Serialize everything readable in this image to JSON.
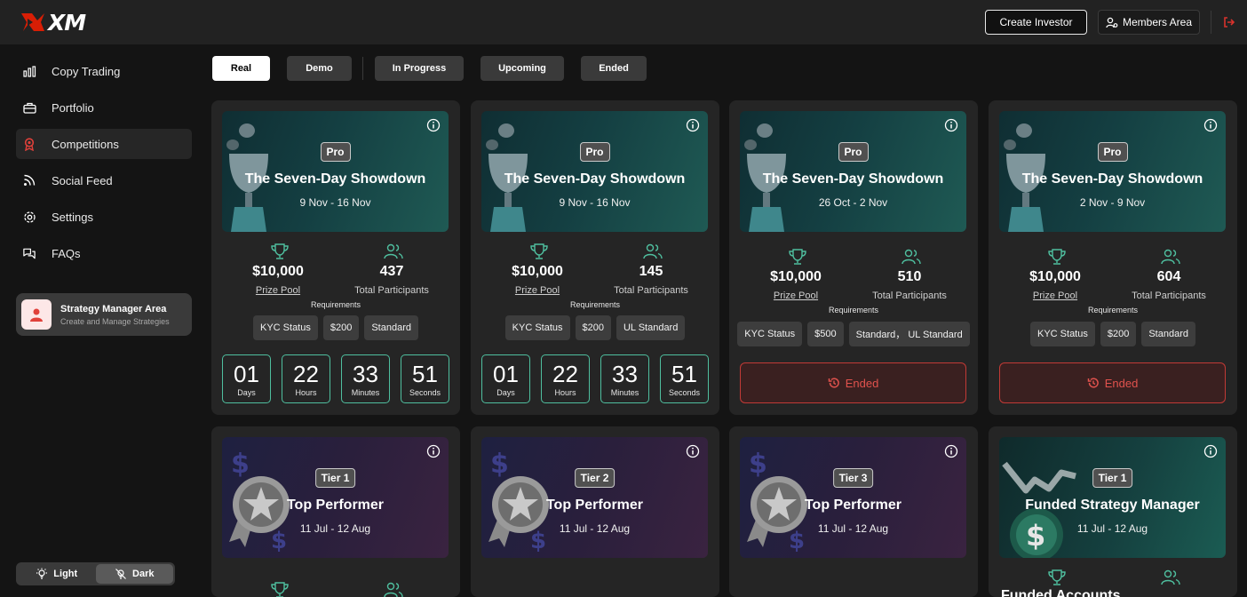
{
  "header": {
    "logo_text": "XM",
    "create_investor": "Create Investor",
    "members_area": "Members Area"
  },
  "sidebar": {
    "items": [
      {
        "label": "Copy Trading",
        "icon": "bar-chart-icon"
      },
      {
        "label": "Portfolio",
        "icon": "briefcase-icon"
      },
      {
        "label": "Competitions",
        "icon": "award-icon",
        "active": true
      },
      {
        "label": "Social Feed",
        "icon": "rss-icon"
      },
      {
        "label": "Settings",
        "icon": "gear-icon"
      },
      {
        "label": "FAQs",
        "icon": "chat-bubbles-icon"
      }
    ],
    "strategy_area": {
      "title": "Strategy Manager Area",
      "subtitle": "Create and Manage Strategies"
    },
    "theme": {
      "light": "Light",
      "dark": "Dark",
      "selected": "Dark"
    }
  },
  "tabs": [
    {
      "label": "Real",
      "active": true
    },
    {
      "label": "Demo"
    },
    {
      "label": "In Progress"
    },
    {
      "label": "Upcoming"
    },
    {
      "label": "Ended"
    }
  ],
  "labels": {
    "prize_pool": "Prize Pool",
    "total_participants": "Total Participants",
    "requirements": "Requirements",
    "ended": "Ended",
    "days": "Days",
    "hours": "Hours",
    "minutes": "Minutes",
    "seconds": "Seconds"
  },
  "competitions": [
    {
      "badge": "Pro",
      "title": "The Seven-Day Showdown",
      "dates": "9 Nov - 16 Nov",
      "prize": "$10,000",
      "participants": "437",
      "requirements": [
        "KYC Status",
        "$200",
        "Standard"
      ],
      "countdown": {
        "days": "01",
        "hours": "22",
        "minutes": "33",
        "seconds": "51"
      }
    },
    {
      "badge": "Pro",
      "title": "The Seven-Day Showdown",
      "dates": "9 Nov - 16 Nov",
      "prize": "$10,000",
      "participants": "145",
      "requirements": [
        "KYC Status",
        "$200",
        "UL Standard"
      ],
      "countdown": {
        "days": "01",
        "hours": "22",
        "minutes": "33",
        "seconds": "51"
      }
    },
    {
      "badge": "Pro",
      "title": "The Seven-Day Showdown",
      "dates": "26 Oct - 2 Nov",
      "prize": "$10,000",
      "participants": "510",
      "requirements": [
        "KYC Status",
        "$500",
        "Standard， UL Standard"
      ],
      "status": "ended"
    },
    {
      "badge": "Pro",
      "title": "The Seven-Day Showdown",
      "dates": "2 Nov - 9 Nov",
      "prize": "$10,000",
      "participants": "604",
      "requirements": [
        "KYC Status",
        "$200",
        "Standard"
      ],
      "status": "ended"
    },
    {
      "badge": "Tier 1",
      "title": "Top Performer",
      "dates": "11 Jul - 12 Aug"
    },
    {
      "badge": "Tier 2",
      "title": "Top Performer",
      "dates": "11 Jul - 12 Aug"
    },
    {
      "badge": "Tier 3",
      "title": "Top Performer",
      "dates": "11 Jul - 12 Aug"
    },
    {
      "badge": "Tier 1",
      "title": "Funded Strategy Manager",
      "dates": "11 Jul - 12 Aug",
      "stat_label": "Funded Accounts"
    }
  ],
  "colors": {
    "accent_teal": "#4fbf9f",
    "ended_red": "#e0524d",
    "brand_red": "#d81e05"
  }
}
